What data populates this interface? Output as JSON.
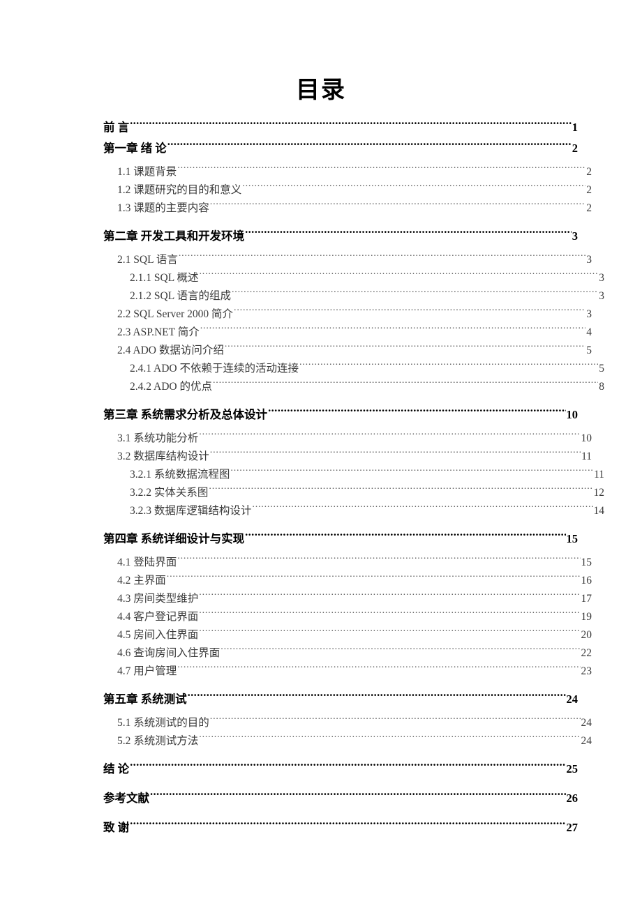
{
  "document": {
    "title": "目录",
    "leader_char": "."
  },
  "toc": {
    "entries": [
      {
        "level": 1,
        "label": "前  言",
        "page": "1",
        "gap_before": false,
        "gap_after": false
      },
      {
        "level": 1,
        "label": "第一章  绪  论",
        "page": "2",
        "gap_before": false,
        "gap_after": true
      },
      {
        "level": 2,
        "label": "1.1 课题背景",
        "page": "2",
        "gap_before": false,
        "gap_after": false
      },
      {
        "level": 2,
        "label": "1.2 课题研究的目的和意义",
        "page": "2",
        "gap_before": false,
        "gap_after": false
      },
      {
        "level": 2,
        "label": "1.3 课题的主要内容",
        "page": "2",
        "gap_before": false,
        "gap_after": false
      },
      {
        "level": 1,
        "label": "第二章  开发工具和开发环境",
        "page": "3",
        "gap_before": true,
        "gap_after": true
      },
      {
        "level": 2,
        "label": "2.1 SQL 语言",
        "page": "3",
        "gap_before": false,
        "gap_after": false
      },
      {
        "level": 3,
        "label": "2.1.1 SQL 概述",
        "page": "3",
        "gap_before": false,
        "gap_after": false
      },
      {
        "level": 3,
        "label": "2.1.2 SQL 语言的组成",
        "page": "3",
        "gap_before": false,
        "gap_after": false
      },
      {
        "level": 2,
        "label": "2.2 SQL Server 2000 简介",
        "page": "3",
        "gap_before": false,
        "gap_after": false
      },
      {
        "level": 2,
        "label": "2.3 ASP.NET 简介",
        "page": "4",
        "gap_before": false,
        "gap_after": false
      },
      {
        "level": 2,
        "label": "2.4 ADO 数据访问介绍",
        "page": "5",
        "gap_before": false,
        "gap_after": false
      },
      {
        "level": 3,
        "label": "2.4.1 ADO 不依赖于连续的活动连接",
        "page": "5",
        "gap_before": false,
        "gap_after": false
      },
      {
        "level": 3,
        "label": "2.4.2 ADO 的优点",
        "page": "8",
        "gap_before": false,
        "gap_after": false
      },
      {
        "level": 1,
        "label": "第三章  系统需求分析及总体设计",
        "page": "10",
        "gap_before": true,
        "gap_after": true
      },
      {
        "level": 2,
        "label": "3.1 系统功能分析",
        "page": "10",
        "gap_before": false,
        "gap_after": false
      },
      {
        "level": 2,
        "label": "3.2 数据库结构设计",
        "page": "11",
        "gap_before": false,
        "gap_after": false
      },
      {
        "level": 3,
        "label": "3.2.1 系统数据流程图",
        "page": "11",
        "gap_before": false,
        "gap_after": false
      },
      {
        "level": 3,
        "label": "3.2.2 实体关系图",
        "page": "12",
        "gap_before": false,
        "gap_after": false
      },
      {
        "level": 3,
        "label": "3.2.3 数据库逻辑结构设计",
        "page": "14",
        "gap_before": false,
        "gap_after": false
      },
      {
        "level": 1,
        "label": "第四章  系统详细设计与实现",
        "page": "15",
        "gap_before": true,
        "gap_after": true
      },
      {
        "level": 2,
        "label": "4.1 登陆界面",
        "page": "15",
        "gap_before": false,
        "gap_after": false
      },
      {
        "level": 2,
        "label": "4.2 主界面",
        "page": "16",
        "gap_before": false,
        "gap_after": false
      },
      {
        "level": 2,
        "label": "4.3 房间类型维护",
        "page": "17",
        "gap_before": false,
        "gap_after": false
      },
      {
        "level": 2,
        "label": "4.4 客户登记界面",
        "page": "19",
        "gap_before": false,
        "gap_after": false
      },
      {
        "level": 2,
        "label": "4.5 房间入住界面",
        "page": "20",
        "gap_before": false,
        "gap_after": false
      },
      {
        "level": 2,
        "label": "4.6 查询房间入住界面",
        "page": "22",
        "gap_before": false,
        "gap_after": false
      },
      {
        "level": 2,
        "label": "4.7 用户管理",
        "page": "23",
        "gap_before": false,
        "gap_after": false
      },
      {
        "level": 1,
        "label": "第五章  系统测试",
        "page": "24",
        "gap_before": true,
        "gap_after": true
      },
      {
        "level": 2,
        "label": "5.1 系统测试的目的",
        "page": "24",
        "gap_before": false,
        "gap_after": false
      },
      {
        "level": 2,
        "label": "5.2 系统测试方法",
        "page": "24",
        "gap_before": false,
        "gap_after": false
      },
      {
        "level": 1,
        "label": "结  论",
        "page": "25",
        "gap_before": true,
        "gap_after": false
      },
      {
        "level": 1,
        "label": "参考文献",
        "page": "26",
        "gap_before": true,
        "gap_after": false
      },
      {
        "level": 1,
        "label": "致  谢",
        "page": "27",
        "gap_before": true,
        "gap_after": false
      }
    ]
  }
}
